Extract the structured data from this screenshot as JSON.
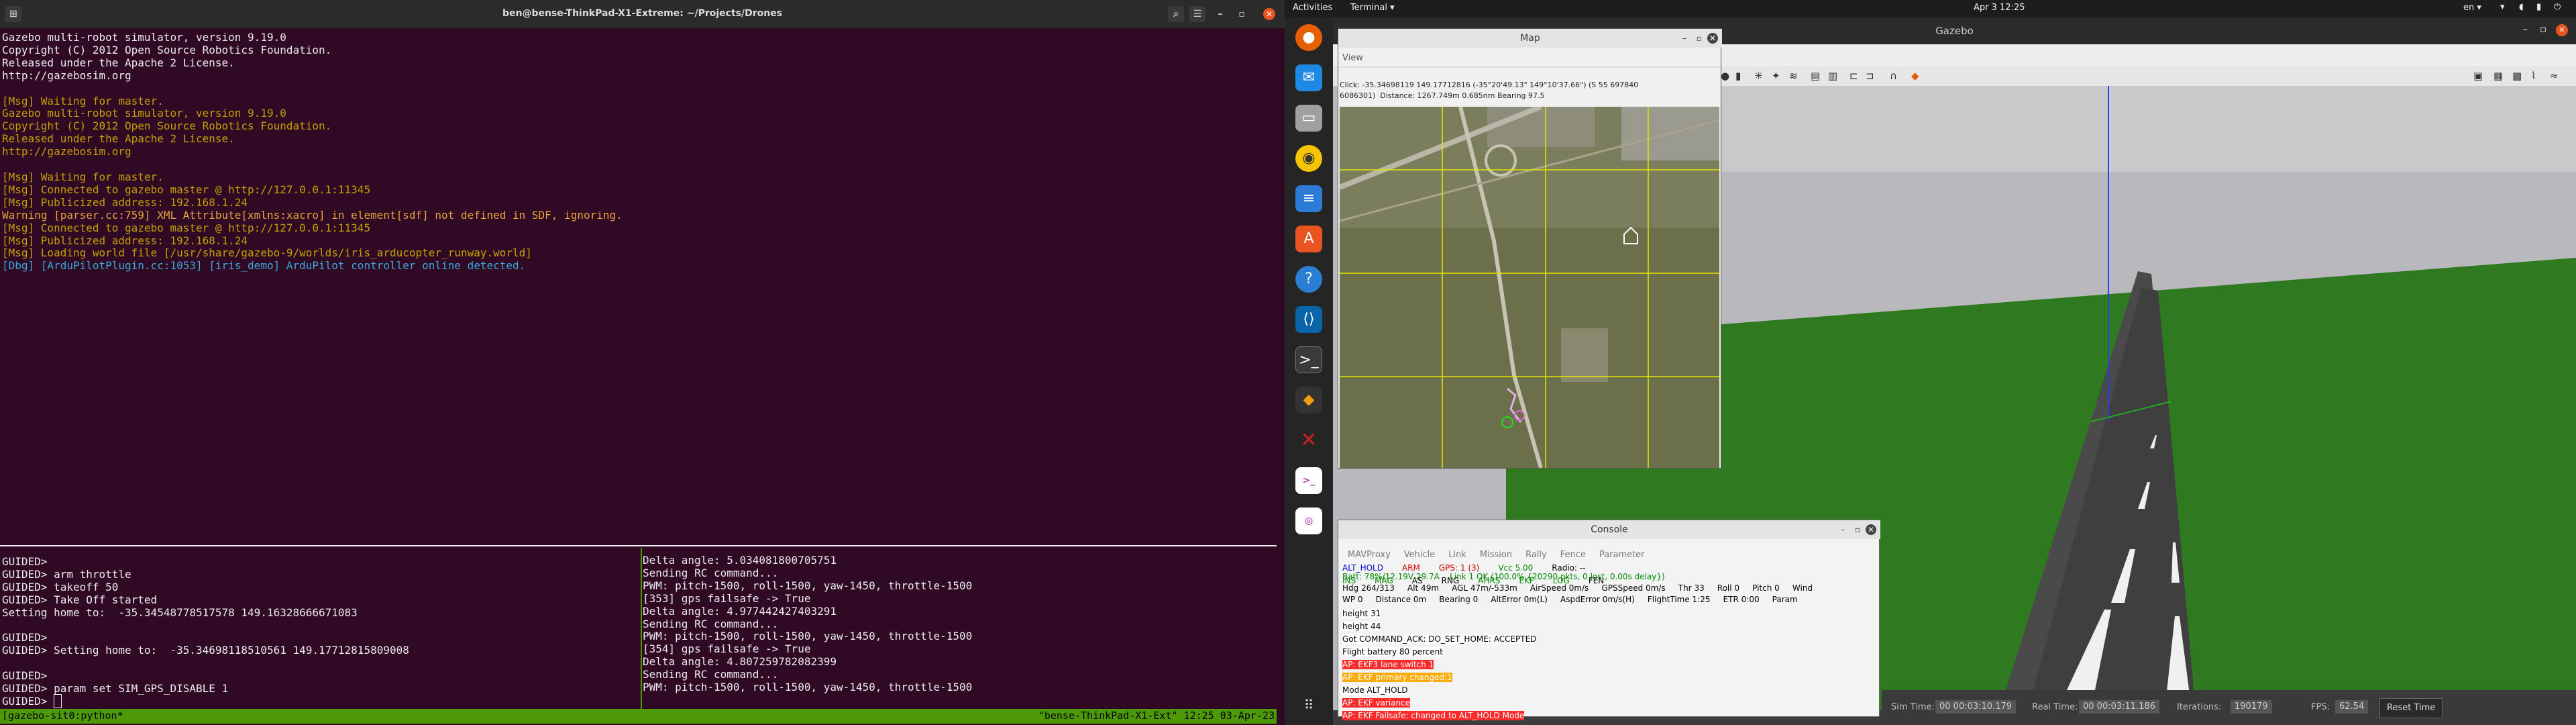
{
  "terminal": {
    "title": "ben@bense-ThinkPad-X1-Extreme: ~/Projects/Drones",
    "lines": [
      {
        "t": "Gazebo multi-robot simulator, version 9.19.0",
        "c": "w"
      },
      {
        "t": "Copyright (C) 2012 Open Source Robotics Foundation.",
        "c": "w"
      },
      {
        "t": "Released under the Apache 2 License.",
        "c": "w"
      },
      {
        "t": "http://gazebosim.org",
        "c": "w"
      },
      {
        "t": "",
        "c": "w"
      },
      {
        "t": "[Msg] Waiting for master.",
        "c": "y"
      },
      {
        "t": "Gazebo multi-robot simulator, version 9.19.0",
        "c": "y"
      },
      {
        "t": "Copyright (C) 2012 Open Source Robotics Foundation.",
        "c": "y"
      },
      {
        "t": "Released under the Apache 2 License.",
        "c": "y"
      },
      {
        "t": "http://gazebosim.org",
        "c": "y"
      },
      {
        "t": "",
        "c": "w"
      },
      {
        "t": "[Msg] Waiting for master.",
        "c": "y"
      },
      {
        "t": "[Msg] Connected to gazebo master @ http://127.0.0.1:11345",
        "c": "y"
      },
      {
        "t": "[Msg] Publicized address: 192.168.1.24",
        "c": "y"
      },
      {
        "t": "Warning [parser.cc:759] XML Attribute[xmlns:xacro] in element[sdf] not defined in SDF, ignoring.",
        "c": "o"
      },
      {
        "t": "[Msg] Connected to gazebo master @ http://127.0.0.1:11345",
        "c": "y"
      },
      {
        "t": "[Msg] Publicized address: 192.168.1.24",
        "c": "y"
      },
      {
        "t": "[Msg] Loading world file [/usr/share/gazebo-9/worlds/iris_arducopter_runway.world]",
        "c": "y"
      },
      {
        "t": "[Dbg] [ArduPilotPlugin.cc:1053] [iris_demo] ArduPilot controller online detected.",
        "c": "c"
      }
    ],
    "pane_left": [
      "GUIDED>",
      "GUIDED> arm throttle",
      "GUIDED> takeoff 50",
      "GUIDED> Take Off started",
      "Setting home to:  -35.34548778517578 149.16328666671083",
      "",
      "GUIDED>",
      "GUIDED> Setting home to:  -35.34698118510561 149.17712815809008",
      "",
      "GUIDED>",
      "GUIDED> param set SIM_GPS_DISABLE 1",
      "GUIDED> "
    ],
    "pane_right": [
      "Delta angle: 5.034081800705751",
      "Sending RC command...",
      "PWM: pitch-1500, roll-1500, yaw-1450, throttle-1500",
      "[353] gps failsafe -> True",
      "Delta angle: 4.977442427403291",
      "Sending RC command...",
      "PWM: pitch-1500, roll-1500, yaw-1450, throttle-1500",
      "[354] gps failsafe -> True",
      "Delta angle: 4.807259782082399",
      "Sending RC command...",
      "PWM: pitch-1500, roll-1500, yaw-1450, throttle-1500"
    ],
    "tmux_left": "[gazebo-sit0:python*",
    "tmux_right": "\"bense-ThinkPad-X1-Ext\" 12:25 03-Apr-23"
  },
  "topbar": {
    "activities": "Activities",
    "app": "Terminal ▾",
    "clock": "Apr 3  12:25",
    "lang": "en ▾"
  },
  "gazebo": {
    "title": "Gazebo",
    "sim_time_label": "Sim Time:",
    "sim_time": "00 00:03:10.179",
    "real_time_label": "Real Time:",
    "real_time": "00 00:03:11.186",
    "iterations_label": "Iterations:",
    "iterations": "190179",
    "fps_label": "FPS:",
    "fps": "62.54",
    "reset_label": "Reset Time"
  },
  "map": {
    "title": "Map",
    "menu": "View",
    "info1": "Click: -35.34698119 149.17712816 (-35°20'49.13\" 149°10'37.66\") (S 55 697840",
    "info2": "6086301)  Distance: 1267.749m 0.685nm Bearing 97.5"
  },
  "console": {
    "title": "Console",
    "menu": [
      "MAVProxy",
      "Vehicle",
      "Link",
      "Mission",
      "Rally",
      "Fence",
      "Parameter"
    ],
    "status_row1": [
      {
        "t": "ALT_HOLD",
        "c": "#0000cc"
      },
      {
        "t": "ARM",
        "c": "#cc0000"
      },
      {
        "t": "GPS: 1 (3)",
        "c": "#cc0000"
      },
      {
        "t": "Vcc 5.00",
        "c": "#008800"
      },
      {
        "t": "Radio: --",
        "c": "#000"
      },
      {
        "t": "INS",
        "c": "#008800"
      },
      {
        "t": "MAG",
        "c": "#008800"
      },
      {
        "t": "AS",
        "c": "#000"
      },
      {
        "t": "RNG",
        "c": "#000"
      },
      {
        "t": "AHRS",
        "c": "#008800"
      },
      {
        "t": "EKF",
        "c": "#008800"
      },
      {
        "t": "LOG",
        "c": "#008800"
      },
      {
        "t": "FEN",
        "c": "#000"
      }
    ],
    "status_row2": "Batt: 78%/12.19V 29.7A    Link 1 OK (100.0% {20290 pkts, 0 lost, 0.00s delay})",
    "status_row3": "Hdg 264/313     Alt 49m     AGL 47m/-533m     AirSpeed 0m/s     GPSSpeed 0m/s     Thr 33     Roll 0     Pitch 0     Wind",
    "status_row4": "WP 0     Distance 0m     Bearing 0     AltError 0m(L)     AspdError 0m/s(H)     FlightTime 1:25     ETR 0:00     Param",
    "messages": [
      {
        "t": "height 31",
        "bg": "#ffffff",
        "c": "#000"
      },
      {
        "t": "height 44",
        "bg": "#ffffff",
        "c": "#000"
      },
      {
        "t": "Got COMMAND_ACK: DO_SET_HOME: ACCEPTED",
        "bg": "#ffffff",
        "c": "#000"
      },
      {
        "t": "Flight battery 80 percent",
        "bg": "#ffffff",
        "c": "#000"
      },
      {
        "t": "AP: EKF3 lane switch 1",
        "bg": "#ff2a2a",
        "c": "#fff"
      },
      {
        "t": "AP: EKF primary changed:1",
        "bg": "#ffaa00",
        "c": "#fff"
      },
      {
        "t": "Mode ALT_HOLD",
        "bg": "#ffffff",
        "c": "#000"
      },
      {
        "t": "AP: EKF variance",
        "bg": "#ff2a2a",
        "c": "#fff"
      },
      {
        "t": "AP: EKF Failsafe: changed to ALT_HOLD Mode",
        "bg": "#ff2a2a",
        "c": "#fff"
      }
    ]
  }
}
